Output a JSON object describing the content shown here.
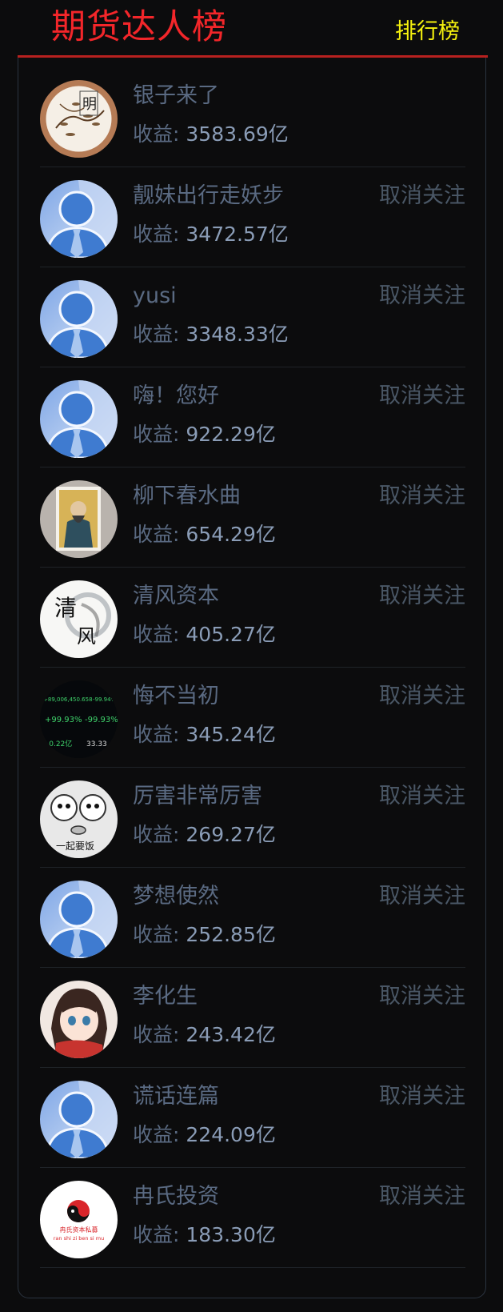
{
  "header": {
    "title": "期货达人榜",
    "rank_link": "排行榜"
  },
  "earnings_label": "收益:",
  "unfollow_label": "取消关注",
  "users": [
    {
      "name": "银子来了",
      "earnings": "3583.69亿",
      "avatar": "ink-painting-avatar",
      "followed": false
    },
    {
      "name": "靓妹出行走妖步",
      "earnings": "3472.57亿",
      "avatar": "default-user-avatar",
      "followed": true
    },
    {
      "name": "yusi",
      "earnings": "3348.33亿",
      "avatar": "default-user-avatar",
      "followed": true
    },
    {
      "name": "嗨！您好",
      "earnings": "922.29亿",
      "avatar": "default-user-avatar",
      "followed": true
    },
    {
      "name": "柳下春水曲",
      "earnings": "654.29亿",
      "avatar": "portrait-painting-avatar",
      "followed": true
    },
    {
      "name": "清风资本",
      "earnings": "405.27亿",
      "avatar": "calligraphy-avatar",
      "followed": true
    },
    {
      "name": "悔不当初",
      "earnings": "345.24亿",
      "avatar": "trading-screen-avatar",
      "followed": true
    },
    {
      "name": "厉害非常厉害",
      "earnings": "269.27亿",
      "avatar": "meme-cartoon-avatar",
      "followed": true
    },
    {
      "name": "梦想使然",
      "earnings": "252.85亿",
      "avatar": "default-user-avatar",
      "followed": true
    },
    {
      "name": "李化生",
      "earnings": "243.42亿",
      "avatar": "anime-girl-avatar",
      "followed": true
    },
    {
      "name": "谎话连篇",
      "earnings": "224.09亿",
      "avatar": "default-user-avatar",
      "followed": true
    },
    {
      "name": "冉氏投资",
      "earnings": "183.30亿",
      "avatar": "logo-avatar",
      "followed": true
    }
  ],
  "avatar_texts": {
    "calligraphy": "清风",
    "trading_row1": "+89,006,450.658",
    "trading_row1b": "-99.94%",
    "trading_row2": "+99.93%",
    "trading_row2b": "-99.93%",
    "trading_row3": "-0.22亿",
    "trading_row3b": "33.33",
    "meme": "一起要饭",
    "logo_cn": "冉氏资本私募",
    "logo_en": "ran shi zi ben si mu"
  }
}
